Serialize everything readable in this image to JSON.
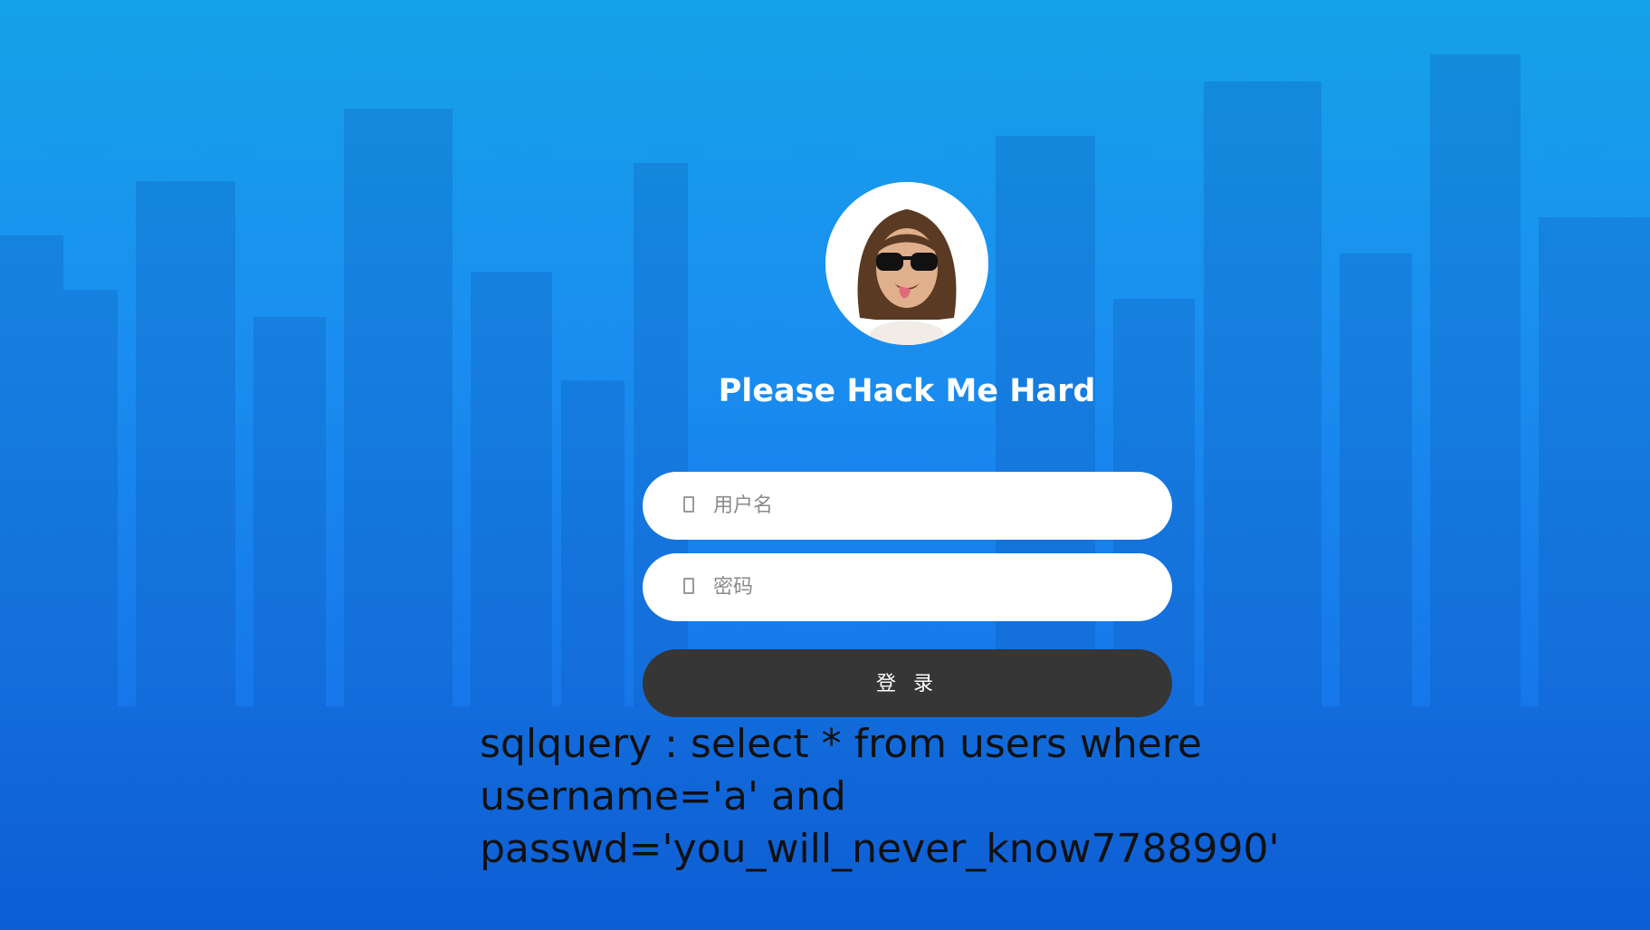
{
  "login": {
    "title": "Please Hack Me Hard",
    "username_placeholder": "用户名",
    "password_placeholder": "密码",
    "submit_label": "登 录",
    "username_icon": "user-icon",
    "password_icon": "lock-icon"
  },
  "debug": {
    "sql_query": "sqlquery : select * from users where username='a' and passwd='you_will_never_know7788990'"
  },
  "colors": {
    "background_top": "#14a2e8",
    "background_bottom": "#0f63e2",
    "button": "#363636",
    "field": "#ffffff"
  }
}
